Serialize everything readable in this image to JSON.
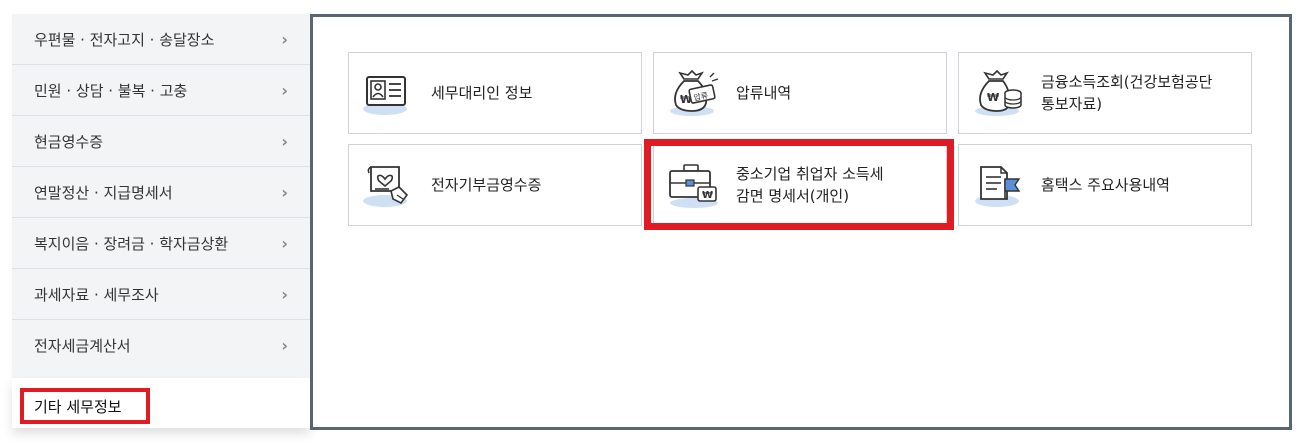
{
  "sidebar": {
    "items": [
      {
        "label": "우편물 · 전자고지 · 송달장소"
      },
      {
        "label": "민원 · 상담 · 불복 · 고충"
      },
      {
        "label": "현금영수증"
      },
      {
        "label": "연말정산 · 지급명세서"
      },
      {
        "label": "복지이음 · 장려금 · 학자금상환"
      },
      {
        "label": "과세자료 · 세무조사"
      },
      {
        "label": "전자세금계산서"
      }
    ],
    "chevron": "›"
  },
  "selected_menu": "기타 세무정보",
  "tiles": [
    {
      "label": "세무대리인 정보",
      "icon": "id-card-icon"
    },
    {
      "label": "압류내역",
      "icon": "money-bag-seized-icon",
      "badge": "압류"
    },
    {
      "label_line1": "금융소득조회(건강보험공단",
      "label_line2": "통보자료)",
      "icon": "money-bag-coins-icon"
    },
    {
      "label": "전자기부금영수증",
      "icon": "donation-receipt-icon"
    },
    {
      "label_line1": "중소기업 취업자 소득세",
      "label_line2": "감면 명세서(개인)",
      "icon": "briefcase-won-icon"
    },
    {
      "label": "홈택스 주요사용내역",
      "icon": "document-flag-icon"
    }
  ],
  "colors": {
    "highlight": "#e01b24",
    "icon_blue": "#5b8fd6",
    "panel_border": "#5a6473"
  }
}
